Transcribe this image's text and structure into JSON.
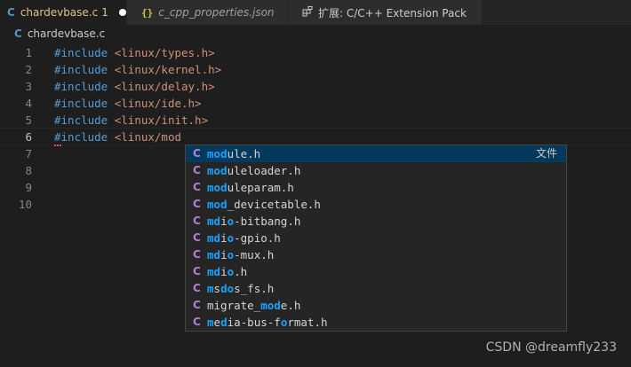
{
  "tabs": [
    {
      "icon": "C",
      "label": "chardevbase.c",
      "badge": "1",
      "dirty": true
    },
    {
      "icon": "{}",
      "label": "c_cpp_properties.json"
    },
    {
      "icon": "ext",
      "label": "扩展: C/C++ Extension Pack"
    }
  ],
  "breadcrumb": {
    "icon": "C",
    "file": "chardevbase.c"
  },
  "editor": {
    "lines": [
      {
        "num": "1",
        "kw": "#include",
        "str": " <linux/types.h>"
      },
      {
        "num": "2",
        "kw": "#include",
        "str": " <linux/kernel.h>"
      },
      {
        "num": "3",
        "kw": "#include",
        "str": " <linux/delay.h>"
      },
      {
        "num": "4",
        "kw": "#include",
        "str": " <linux/ide.h>"
      },
      {
        "num": "5",
        "kw": "#include",
        "str": " <linux/init.h>"
      },
      {
        "num": "6",
        "kw": "#include",
        "str": " <linux/mod"
      },
      {
        "num": "7",
        "kw": "",
        "str": ""
      },
      {
        "num": "8",
        "kw": "",
        "str": ""
      },
      {
        "num": "9",
        "kw": "",
        "str": ""
      },
      {
        "num": "10",
        "kw": "",
        "str": ""
      }
    ],
    "current_line": "6"
  },
  "suggest": {
    "items": [
      {
        "icon": "C",
        "label": "module.h",
        "detail": "文件"
      },
      {
        "icon": "C",
        "label": "moduleloader.h"
      },
      {
        "icon": "C",
        "label": "moduleparam.h"
      },
      {
        "icon": "C",
        "label": "mod_devicetable.h"
      },
      {
        "icon": "C",
        "label": "mdio-bitbang.h"
      },
      {
        "icon": "C",
        "label": "mdio-gpio.h"
      },
      {
        "icon": "C",
        "label": "mdio-mux.h"
      },
      {
        "icon": "C",
        "label": "mdio.h"
      },
      {
        "icon": "C",
        "label": "msdos_fs.h"
      },
      {
        "icon": "C",
        "label": "migrate_mode.h"
      },
      {
        "icon": "C",
        "label": "media-bus-format.h"
      }
    ]
  },
  "watermark": "CSDN @dreamfly233",
  "colors": {
    "background": "#1e1e1e",
    "keyword": "#569cd6",
    "string": "#ce9178",
    "match_highlight": "#18a3ff",
    "selection": "#04395e",
    "c_icon": "#519aba",
    "class_icon": "#b180d7"
  }
}
